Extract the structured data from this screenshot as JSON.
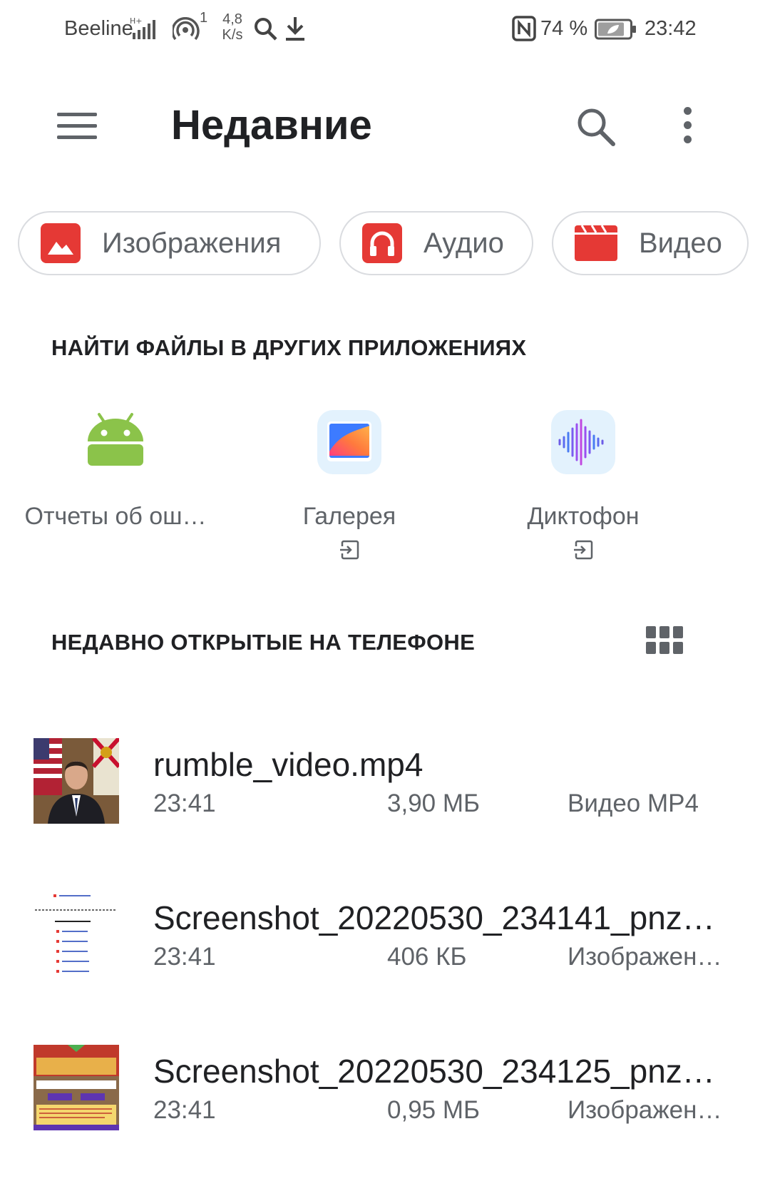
{
  "status_bar": {
    "carrier": "Beeline",
    "signal_superscript": "1",
    "net_speed_value": "4,8",
    "net_speed_unit": "K/s",
    "battery_percent": "74 %",
    "time": "23:42",
    "icons": [
      "signal-icon",
      "hotspot-icon",
      "search-icon",
      "download-icon",
      "nfc-icon",
      "battery-icon"
    ]
  },
  "app_bar": {
    "title": "Недавние"
  },
  "chips": [
    {
      "label": "Изображения",
      "icon": "image-icon"
    },
    {
      "label": "Аудио",
      "icon": "headphones-icon"
    },
    {
      "label": "Видео",
      "icon": "clapperboard-icon"
    }
  ],
  "other_apps": {
    "title": "НАЙТИ ФАЙЛЫ В ДРУГИХ ПРИЛОЖЕНИЯХ",
    "apps": [
      {
        "label": "Отчеты об ош…",
        "icon": "android-icon"
      },
      {
        "label": "Галерея",
        "icon": "gallery-icon"
      },
      {
        "label": "Диктофон",
        "icon": "recorder-icon"
      }
    ]
  },
  "recent": {
    "title": "НЕДАВНО ОТКРЫТЫЕ НА ТЕЛЕФОНЕ",
    "files": [
      {
        "name": "rumble_video.mp4",
        "time": "23:41",
        "size": "3,90 МБ",
        "type": "Видео MP4"
      },
      {
        "name": "Screenshot_20220530_234141_pnz…",
        "time": "23:41",
        "size": "406 КБ",
        "type": "Изображен…"
      },
      {
        "name": "Screenshot_20220530_234125_pnz…",
        "time": "23:41",
        "size": "0,95 МБ",
        "type": "Изображен…"
      }
    ]
  },
  "colors": {
    "accent_red": "#e53935",
    "android_green": "#8bc34a"
  }
}
